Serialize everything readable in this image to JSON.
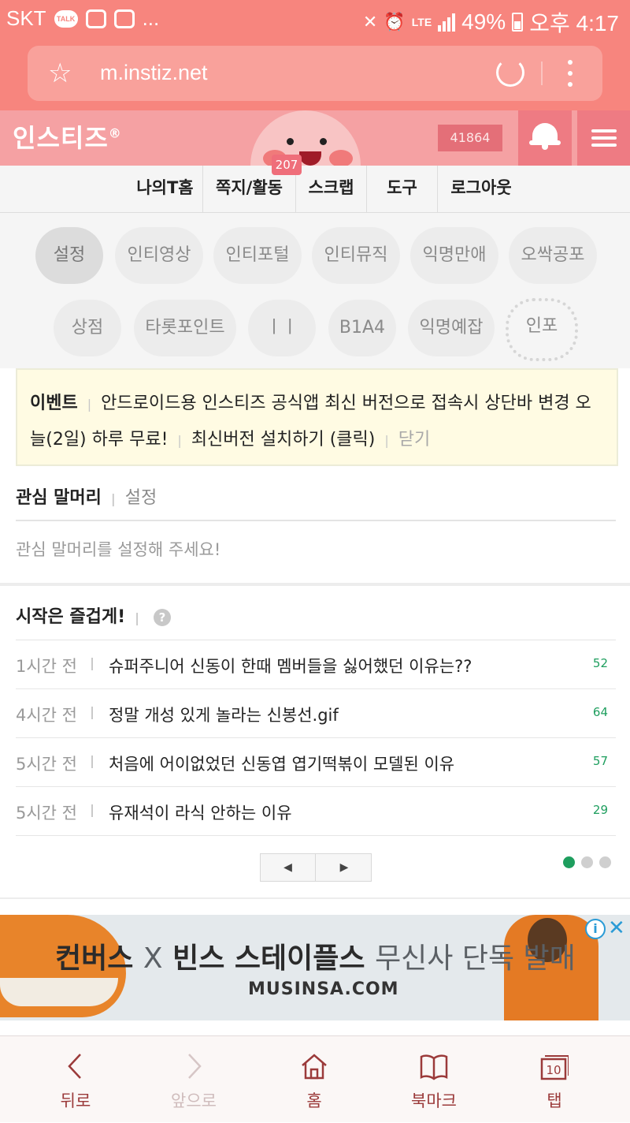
{
  "status_bar": {
    "carrier": "SKT",
    "talk_label": "TALK",
    "more": "...",
    "network": "LTE",
    "battery": "49%",
    "time": "오후 4:17"
  },
  "browser": {
    "url": "m.instiz.net"
  },
  "header": {
    "logo": "인스티즈",
    "logo_mark": "®",
    "points": "41864"
  },
  "nav": {
    "items": [
      "나의T홈",
      "쪽지/활동",
      "스크랩",
      "도구",
      "로그아웃"
    ],
    "badge": "207"
  },
  "chips": {
    "row1": [
      "설정",
      "인티영상",
      "인티포털",
      "인티뮤직",
      "익명만애",
      "오싹공포"
    ],
    "row2": [
      "상점",
      "타롯포인트",
      "ㅣㅣ",
      "B1A4",
      "익명예잡",
      "인포"
    ]
  },
  "notice": {
    "title": "이벤트",
    "text": "안드로이드용 인스티즈 공식앱 최신 버전으로 접속시 상단바 변경 오늘(2일) 하루 무료!",
    "link": "최신버전 설치하기 (클릭)",
    "close": "닫기"
  },
  "interest": {
    "title": "관심 말머리",
    "setting": "설정",
    "empty": "관심 말머리를 설정해 주세요!"
  },
  "feed": {
    "title": "시작은 즐겁게!",
    "help": "?",
    "rows": [
      {
        "time": "1시간 전",
        "title": "슈퍼주니어 신동이 한때 멤버들을 싫어했던 이유는??",
        "count": "52"
      },
      {
        "time": "4시간 전",
        "title": "정말 개성 있게 놀라는 신봉선.gif",
        "count": "64"
      },
      {
        "time": "5시간 전",
        "title": "처음에 어이없었던 신동엽 엽기떡볶이 모델된 이유",
        "count": "57"
      },
      {
        "time": "5시간 전",
        "title": "유재석이 라식 안하는 이유",
        "count": "29"
      }
    ],
    "prev": "◀",
    "next": "▶"
  },
  "ad": {
    "headline_a": "컨버스",
    "headline_x": "X",
    "headline_b": "빈스 스테이플스",
    "headline_c": "무신사 단독 발매",
    "domain": "MUSINSA.COM",
    "info": "i",
    "close": "✕"
  },
  "toolbar": {
    "back": "뒤로",
    "forward": "앞으로",
    "home": "홈",
    "bookmark": "북마크",
    "tabs": "탭",
    "tab_count": "10"
  },
  "colors": {
    "status_bar": "#f7857e",
    "header": "#f5a1a3",
    "accent_green": "#1e9e5e",
    "toolbar_icon": "#9b3a3a"
  }
}
